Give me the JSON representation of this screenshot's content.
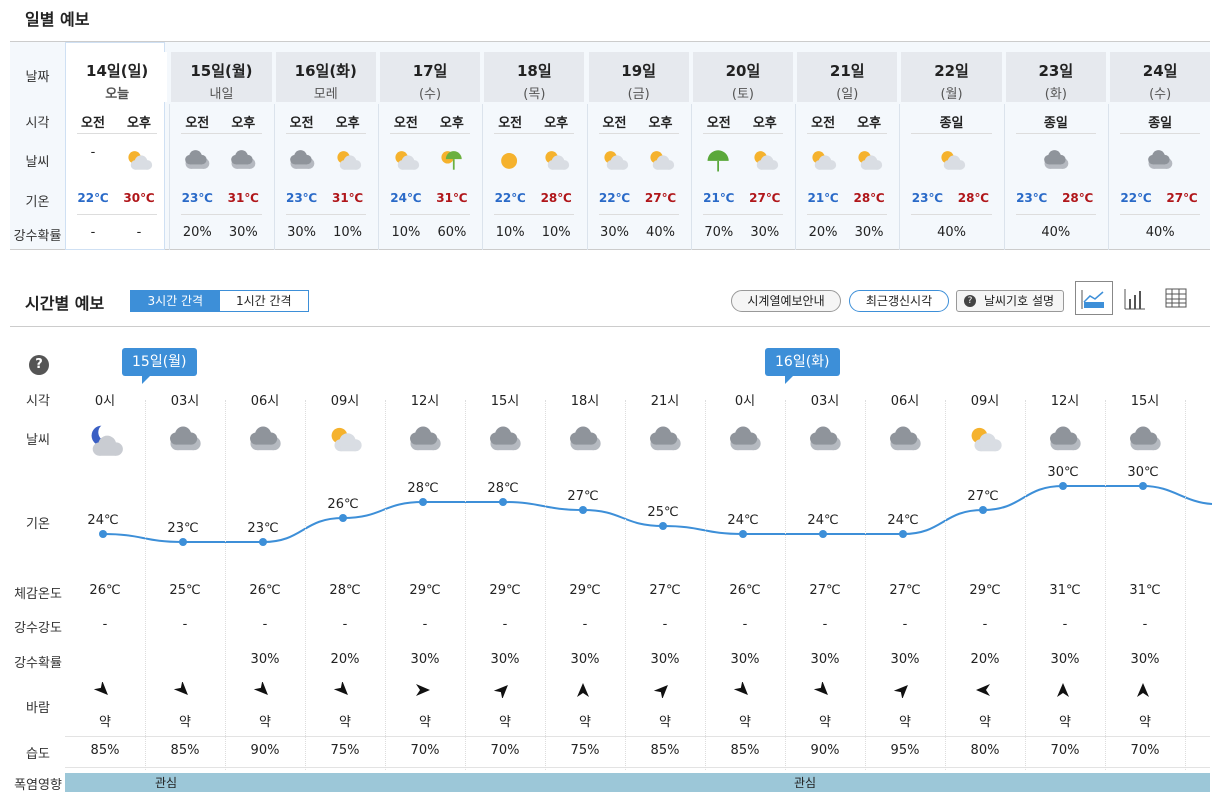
{
  "daily": {
    "title": "일별 예보",
    "labels": {
      "date": "날짜",
      "time": "시각",
      "weather": "날씨",
      "temp": "기온",
      "precip": "강수확률"
    },
    "days": [
      {
        "date": "14일(일)",
        "sub": "오늘",
        "color": "red",
        "am": "오전",
        "pm": "오후",
        "w_am": "-",
        "w_pm": "cloud-sun",
        "lo": "22℃",
        "hi": "30℃",
        "p_am": "-",
        "p_pm": "-"
      },
      {
        "date": "15일(월)",
        "sub": "내일",
        "color": "dark",
        "am": "오전",
        "pm": "오후",
        "w_am": "cloud",
        "w_pm": "cloud",
        "lo": "23℃",
        "hi": "31℃",
        "p_am": "20%",
        "p_pm": "30%"
      },
      {
        "date": "16일(화)",
        "sub": "모레",
        "color": "dark",
        "am": "오전",
        "pm": "오후",
        "w_am": "cloud",
        "w_pm": "cloud-sun",
        "lo": "23℃",
        "hi": "31℃",
        "p_am": "30%",
        "p_pm": "10%"
      },
      {
        "date": "17일",
        "sub": "(수)",
        "color": "dark",
        "am": "오전",
        "pm": "오후",
        "w_am": "cloud-sun",
        "w_pm": "shower",
        "lo": "24℃",
        "hi": "31℃",
        "p_am": "10%",
        "p_pm": "60%"
      },
      {
        "date": "18일",
        "sub": "(목)",
        "color": "dark",
        "am": "오전",
        "pm": "오후",
        "w_am": "sun",
        "w_pm": "cloud-sun",
        "lo": "22℃",
        "hi": "28℃",
        "p_am": "10%",
        "p_pm": "10%"
      },
      {
        "date": "19일",
        "sub": "(금)",
        "color": "dark",
        "am": "오전",
        "pm": "오후",
        "w_am": "cloud-sun",
        "w_pm": "cloud-sun",
        "lo": "22℃",
        "hi": "27℃",
        "p_am": "30%",
        "p_pm": "40%"
      },
      {
        "date": "20일",
        "sub": "(토)",
        "color": "blue",
        "am": "오전",
        "pm": "오후",
        "w_am": "umbrella",
        "w_pm": "cloud-sun",
        "lo": "21℃",
        "hi": "27℃",
        "p_am": "70%",
        "p_pm": "30%"
      },
      {
        "date": "21일",
        "sub": "(일)",
        "color": "red",
        "am": "오전",
        "pm": "오후",
        "w_am": "cloud-sun",
        "w_pm": "cloud-sun",
        "lo": "21℃",
        "hi": "28℃",
        "p_am": "20%",
        "p_pm": "30%"
      },
      {
        "date": "22일",
        "sub": "(월)",
        "color": "dark",
        "am": "종일",
        "w_am": "cloud-sun",
        "lo": "23℃",
        "hi": "28℃",
        "p_am": "40%"
      },
      {
        "date": "23일",
        "sub": "(화)",
        "color": "dark",
        "am": "종일",
        "w_am": "cloud",
        "lo": "23℃",
        "hi": "28℃",
        "p_am": "40%"
      },
      {
        "date": "24일",
        "sub": "(수)",
        "color": "dark",
        "am": "종일",
        "w_am": "cloud",
        "lo": "22℃",
        "hi": "27℃",
        "p_am": "40%"
      }
    ]
  },
  "hourly": {
    "title": "시간별 예보",
    "tabs": [
      "3시간 간격",
      "1시간 간격"
    ],
    "buttons": [
      "시계열예보안내",
      "최근갱신시각",
      "날씨기호 설명"
    ],
    "help": "?",
    "bubbles": [
      "15일(월)",
      "16일(화)"
    ],
    "labels": {
      "time": "시각",
      "weather": "날씨",
      "temp": "기온",
      "feel": "체감온도",
      "intensity": "강수강도",
      "precip": "강수확률",
      "wind": "바람",
      "humidity": "습도",
      "heat": "폭염영향"
    },
    "cols": [
      {
        "t": "0시",
        "w": "moon-cloud",
        "temp": 24,
        "tl": "24℃",
        "feel": "26℃",
        "int": "-",
        "p": "",
        "wind_deg": 45,
        "ws": "약",
        "hum": "85%"
      },
      {
        "t": "03시",
        "w": "cloud",
        "temp": 23,
        "tl": "23℃",
        "feel": "25℃",
        "int": "-",
        "p": "",
        "wind_deg": 45,
        "ws": "약",
        "hum": "85%"
      },
      {
        "t": "06시",
        "w": "cloud",
        "temp": 23,
        "tl": "23℃",
        "feel": "26℃",
        "int": "-",
        "p": "30%",
        "wind_deg": 45,
        "ws": "약",
        "hum": "90%"
      },
      {
        "t": "09시",
        "w": "cloud-sun",
        "temp": 26,
        "tl": "26℃",
        "feel": "28℃",
        "int": "-",
        "p": "20%",
        "wind_deg": 45,
        "ws": "약",
        "hum": "75%"
      },
      {
        "t": "12시",
        "w": "cloud",
        "temp": 28,
        "tl": "28℃",
        "feel": "29℃",
        "int": "-",
        "p": "30%",
        "wind_deg": 0,
        "ws": "약",
        "hum": "70%"
      },
      {
        "t": "15시",
        "w": "cloud",
        "temp": 28,
        "tl": "28℃",
        "feel": "29℃",
        "int": "-",
        "p": "30%",
        "wind_deg": -45,
        "ws": "약",
        "hum": "70%"
      },
      {
        "t": "18시",
        "w": "cloud",
        "temp": 27,
        "tl": "27℃",
        "feel": "29℃",
        "int": "-",
        "p": "30%",
        "wind_deg": -90,
        "ws": "약",
        "hum": "75%"
      },
      {
        "t": "21시",
        "w": "cloud",
        "temp": 25,
        "tl": "25℃",
        "feel": "27℃",
        "int": "-",
        "p": "30%",
        "wind_deg": -45,
        "ws": "약",
        "hum": "85%"
      },
      {
        "t": "0시",
        "w": "cloud",
        "temp": 24,
        "tl": "24℃",
        "feel": "26℃",
        "int": "-",
        "p": "30%",
        "wind_deg": 45,
        "ws": "약",
        "hum": "85%"
      },
      {
        "t": "03시",
        "w": "cloud",
        "temp": 24,
        "tl": "24℃",
        "feel": "27℃",
        "int": "-",
        "p": "30%",
        "wind_deg": 45,
        "ws": "약",
        "hum": "90%"
      },
      {
        "t": "06시",
        "w": "cloud",
        "temp": 24,
        "tl": "24℃",
        "feel": "27℃",
        "int": "-",
        "p": "30%",
        "wind_deg": -45,
        "ws": "약",
        "hum": "95%"
      },
      {
        "t": "09시",
        "w": "cloud-sun",
        "temp": 27,
        "tl": "27℃",
        "feel": "29℃",
        "int": "-",
        "p": "20%",
        "wind_deg": 180,
        "ws": "약",
        "hum": "80%"
      },
      {
        "t": "12시",
        "w": "cloud",
        "temp": 30,
        "tl": "30℃",
        "feel": "31℃",
        "int": "-",
        "p": "30%",
        "wind_deg": -90,
        "ws": "약",
        "hum": "70%"
      },
      {
        "t": "15시",
        "w": "cloud",
        "temp": 30,
        "tl": "30℃",
        "feel": "31℃",
        "int": "-",
        "p": "30%",
        "wind_deg": -90,
        "ws": "약",
        "hum": "70%"
      }
    ],
    "heat": [
      "관심",
      "관심"
    ]
  }
}
